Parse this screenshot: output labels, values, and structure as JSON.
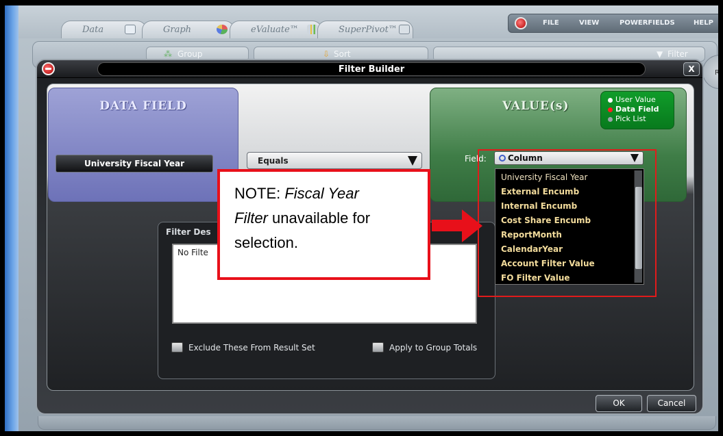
{
  "tabs": [
    {
      "label": "Data"
    },
    {
      "label": "Graph"
    },
    {
      "label": "eValuate™"
    },
    {
      "label": "SuperPivot™"
    }
  ],
  "menu": [
    "FILE",
    "VIEW",
    "POWERFIELDS",
    "HELP"
  ],
  "toolbar": {
    "group": "Group",
    "sort": "Sort",
    "filter": "Filter",
    "refresh": "Ref"
  },
  "dialog": {
    "title": "Filter Builder",
    "close": "X",
    "data_field_heading": "DATA FIELD",
    "data_field_value": "University Fiscal Year",
    "operator": "Equals",
    "value_heading": "VALUE(s)",
    "value_modes": [
      {
        "label": "User Value",
        "selected": false,
        "color": "#ffffff"
      },
      {
        "label": "Data Field",
        "selected": true,
        "color": "#ff2020"
      },
      {
        "label": "Pick List",
        "selected": false,
        "color": "#9aa3a9"
      }
    ],
    "field_label": "Field:",
    "field_value": "Column",
    "dropdown_items": [
      "University Fiscal Year",
      "External Encumb",
      "Internal Encumb",
      "Cost Share Encumb",
      "ReportMonth",
      "CalendarYear",
      "Account Filter Value",
      "FO Filter Value"
    ],
    "filter_desc_label": "Filter Des",
    "filter_desc_text": "No Filte",
    "exclude_label": "Exclude These From Result Set",
    "apply_label": "Apply to Group Totals",
    "ok_label": "OK",
    "cancel_label": "Cancel"
  },
  "note": {
    "prefix": "NOTE: ",
    "italic": "Fiscal Year Filter",
    "suffix": " unavailable for selection.",
    "line1_plain": "NOTE: ",
    "line1_italic": "Fiscal Year",
    "line2_italic": "Filter",
    "line2_plain": " unavailable for",
    "line3_plain": "selection."
  },
  "colors": {
    "annotation_red": "#e8101a",
    "data_field_panel": "#6d72b8",
    "value_panel": "#3f7d47"
  }
}
